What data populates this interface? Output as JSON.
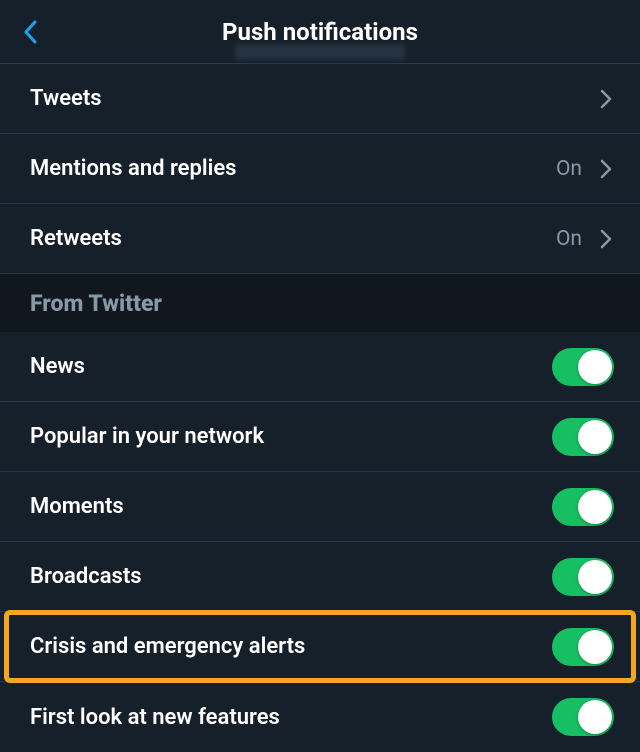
{
  "header": {
    "title": "Push notifications"
  },
  "rows": {
    "tweets": {
      "label": "Tweets"
    },
    "mentions": {
      "label": "Mentions and replies",
      "value": "On"
    },
    "retweets": {
      "label": "Retweets",
      "value": "On"
    }
  },
  "section": {
    "from_twitter": "From Twitter"
  },
  "toggles": {
    "news": {
      "label": "News"
    },
    "popular": {
      "label": "Popular in your network"
    },
    "moments": {
      "label": "Moments"
    },
    "broadcasts": {
      "label": "Broadcasts"
    },
    "crisis": {
      "label": "Crisis and emergency alerts"
    },
    "first_look": {
      "label": "First look at new features"
    }
  },
  "colors": {
    "accent": "#1da1f2",
    "toggle_on": "#17bf63",
    "highlight": "#f5a623"
  }
}
